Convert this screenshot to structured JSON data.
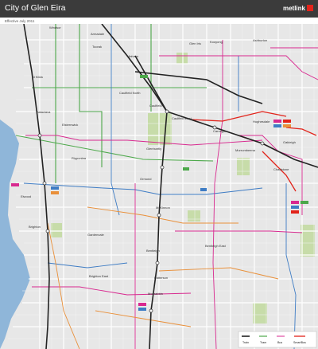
{
  "header": {
    "title": "City of Glen Eira",
    "effective": "Effective July 2011",
    "brand": "metlink"
  },
  "colors": {
    "header_bg": "#3b3b3b",
    "map_bg": "#e7e7e7",
    "water": "#8fb6d9",
    "park": "#c7dca9",
    "train": "#222222",
    "tram": "#4ca84a",
    "bus_blue": "#3e7cc4",
    "bus_pink": "#d8298f",
    "bus_orange": "#e9903a",
    "smartbus": "#e2231a",
    "brand_red": "#e2231a"
  },
  "map": {
    "places": [
      "Windsor",
      "Armadale",
      "Toorak",
      "Malvern",
      "Kooyong",
      "Glen Iris",
      "Ashburton",
      "St Kilda",
      "Caulfield",
      "Caulfield North",
      "Caulfield East",
      "Carnegie",
      "Glenhuntly",
      "Elsternwick",
      "Brighton",
      "Gardenvale",
      "Ormond",
      "McKinnon",
      "Bentleigh",
      "Bentleigh East",
      "Moorabbin",
      "Patterson",
      "Hughesdale",
      "Murrumbeena",
      "Chadstone",
      "Oakleigh",
      "Brighton East",
      "Elwood",
      "Balaclava",
      "Ripponlea"
    ],
    "legend": [
      "Train",
      "Tram",
      "Bus",
      "SmartBus"
    ]
  }
}
